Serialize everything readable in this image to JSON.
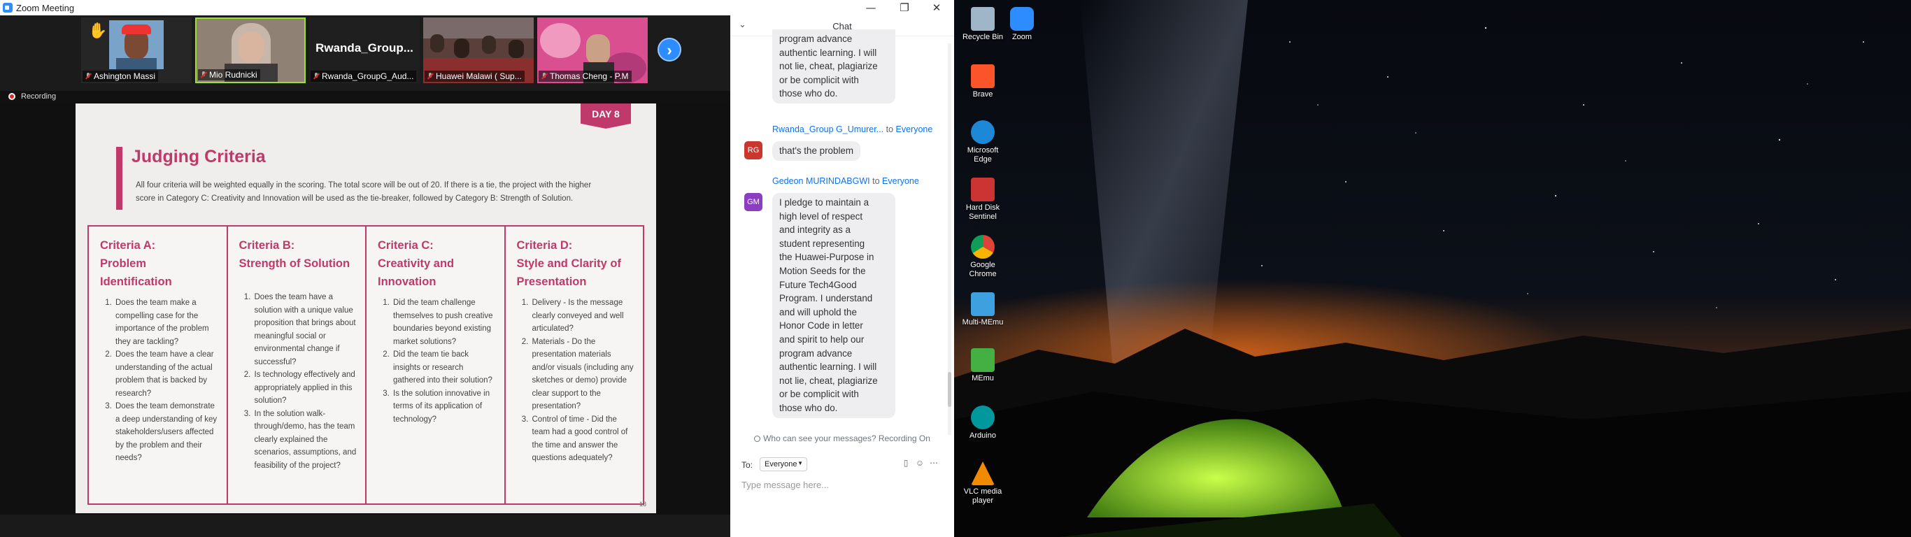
{
  "zoom": {
    "window_title": "Zoom Meeting",
    "window_controls": {
      "minimize": "—",
      "maximize": "❐",
      "close": "✕"
    },
    "participants": [
      {
        "name": "Ashington Massi",
        "raised_hand": "✋"
      },
      {
        "name": "Mio Rudnicki"
      },
      {
        "name": "Rwanda_GroupG_Aud...",
        "display": "Rwanda_Group..."
      },
      {
        "name": "Huawei Malawi ( Sup..."
      },
      {
        "name": "Thomas Cheng - P.M"
      }
    ],
    "next_arrow": "›",
    "recording_label": "Recording"
  },
  "slide": {
    "day_badge": "DAY 8",
    "title": "Judging Criteria",
    "intro_line1": "All four criteria will be weighted equally in the scoring. The total score will be out of 20. If there is a tie, the project with the higher",
    "intro_line2": "score in Category C: Creativity and Innovation will be used as the tie-breaker, followed by Category B: Strength of Solution.",
    "criteria": [
      {
        "heading": [
          "Criteria A:",
          "Problem",
          "Identification"
        ],
        "items": [
          "Does the team make a compelling case for the importance of the problem they are tackling?",
          "Does the team have a clear understanding of the actual problem that is backed by research?",
          "Does the team demonstrate a deep understanding of key stakeholders/users affected by the problem and their needs?"
        ]
      },
      {
        "heading": [
          "Criteria B:",
          "Strength of Solution"
        ],
        "items": [
          "Does the team have a solution with a unique value proposition that brings about meaningful social or environmental change if successful?",
          "Is technology effectively and appropriately applied in this solution?",
          "In the solution walk-through/demo, has the team clearly explained the scenarios, assumptions, and feasibility of the project?"
        ]
      },
      {
        "heading": [
          "Criteria C:",
          "Creativity and",
          "Innovation"
        ],
        "items": [
          "Did the team challenge themselves to push creative boundaries beyond existing market solutions?",
          "Did the team tie back insights or research gathered into their solution?",
          "Is the solution innovative in terms of its application of technology?"
        ]
      },
      {
        "heading": [
          "Criteria D:",
          "Style and Clarity of",
          "Presentation"
        ],
        "items": [
          "Delivery - Is the message clearly conveyed and well articulated?",
          "Materials - Do the presentation materials and/or visuals (including any sketches or demo) provide clear support to the presentation?",
          "Control of time - Did the team had a good control of the time and answer the questions adequately?"
        ]
      }
    ],
    "page_number": "18"
  },
  "chat": {
    "title": "Chat",
    "collapse": "⌄",
    "top_fragment": [
      "program advance",
      "authentic learning. I will",
      "not lie, cheat, plagiarize",
      "or be complicit with",
      "those who do."
    ],
    "messages": [
      {
        "sender": "Rwanda_Group G_Umurer...",
        "to_word": "to",
        "recipient": "Everyone",
        "initials": "RG",
        "avatar_color": "#c9382f",
        "lines": [
          "that's the problem"
        ]
      },
      {
        "sender": "Gedeon MURINDABGWI",
        "to_word": "to",
        "recipient": "Everyone",
        "initials": "GM",
        "avatar_color": "#8b3fc0",
        "lines": [
          "I pledge to maintain a",
          "high level of respect",
          "and integrity as a",
          "student representing",
          "the Huawei-Purpose in",
          "Motion Seeds for the",
          "Future Tech4Good",
          "Program. I understand",
          "and will uphold the",
          "Honor Code in letter",
          "and spirit to help our",
          "program advance",
          "authentic learning. I will",
          "not lie, cheat, plagiarize",
          "or be complicit with",
          "those who do."
        ]
      }
    ],
    "visibility_notice": "Who can see your messages? Recording On",
    "to_label": "To:",
    "to_value": "Everyone",
    "input_placeholder": "Type message here..."
  },
  "desktop": {
    "icons": [
      {
        "label": [
          "Recycle Bin"
        ],
        "color": "#9fb5c8"
      },
      {
        "label": [
          "Zoom"
        ],
        "color": "#2d8cff"
      },
      {
        "label": [
          "Brave"
        ],
        "color": "#fb542b"
      },
      {
        "label": [
          "Microsoft",
          "Edge"
        ],
        "color": "#1e88d8"
      },
      {
        "label": [
          "Hard Disk",
          "Sentinel"
        ],
        "color": "#c33"
      },
      {
        "label": [
          "Google",
          "Chrome"
        ],
        "color": "#e8b100"
      },
      {
        "label": [
          "Multi-MEmu"
        ],
        "color": "#3fa0e0"
      },
      {
        "label": [
          "MEmu"
        ],
        "color": "#44b044"
      },
      {
        "label": [
          "Arduino"
        ],
        "color": "#00979d"
      },
      {
        "label": [
          "VLC media",
          "player"
        ],
        "color": "#f08a00"
      }
    ]
  }
}
